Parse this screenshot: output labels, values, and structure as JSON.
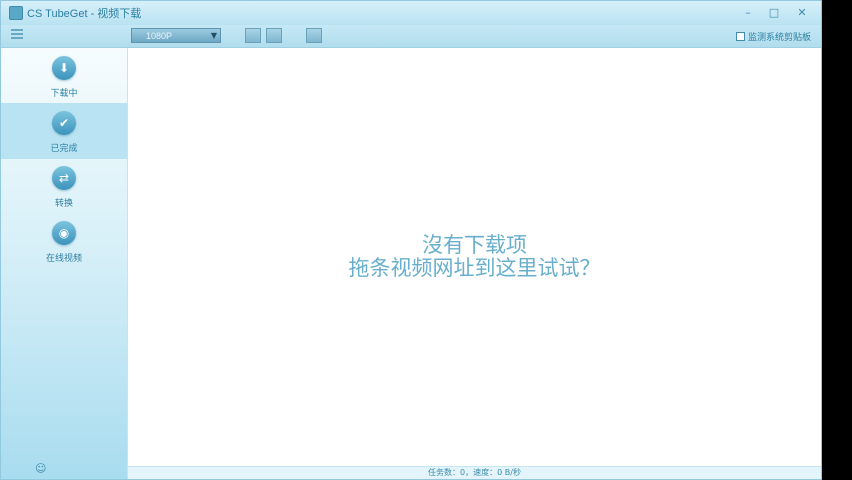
{
  "window": {
    "title": "CS TubeGet - 视频下载",
    "minimize": "–",
    "maximize": "□",
    "close": "✕"
  },
  "toolbar": {
    "quality_value": "1080P",
    "monitor_clipboard_label": "监测系统剪贴板",
    "monitor_checked": false
  },
  "sidebar": {
    "items": [
      {
        "label": "下载中",
        "icon": "download-icon",
        "active": false
      },
      {
        "label": "已完成",
        "icon": "check-icon",
        "active": true
      },
      {
        "label": "转换",
        "icon": "convert-icon",
        "active": false
      },
      {
        "label": "在线视频",
        "icon": "globe-icon",
        "active": false
      }
    ]
  },
  "main": {
    "empty_line1": "沒有下载项",
    "empty_line2": "拖条视频网址到这里试试？"
  },
  "status": {
    "text": "任务数：0，速度：0 B/秒"
  },
  "colors": {
    "accent": "#3b93bb",
    "sidebar_bg": "#bfe6f3",
    "text": "#69afcc"
  }
}
